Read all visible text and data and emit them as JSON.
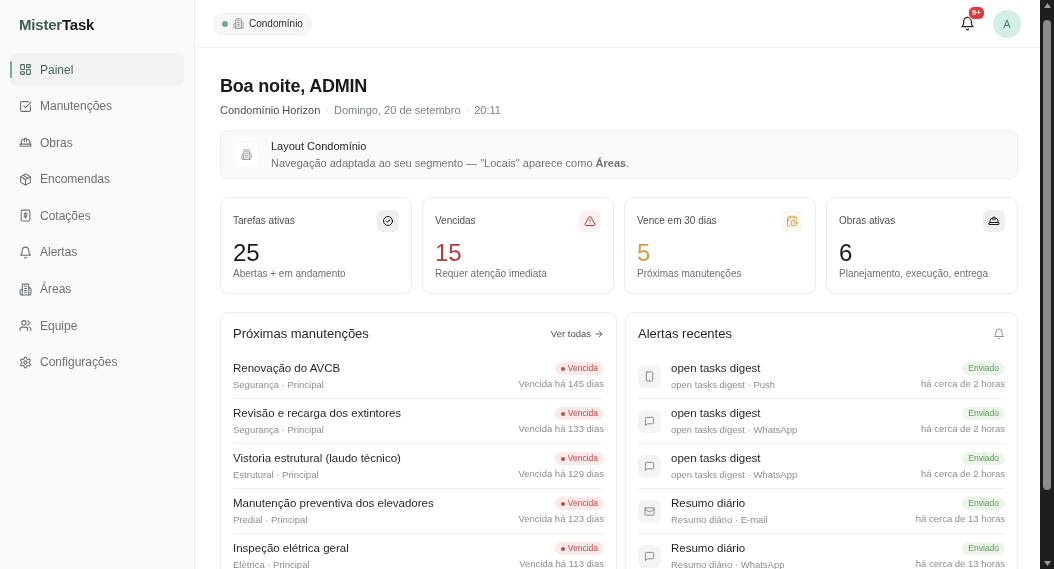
{
  "sidebar": {
    "brand_first": "Mister",
    "brand_second": "Task",
    "items": [
      {
        "label": "Painel",
        "selected": true
      },
      {
        "label": "Manutenções",
        "selected": false
      },
      {
        "label": "Obras",
        "selected": false
      },
      {
        "label": "Encomendas",
        "selected": false
      },
      {
        "label": "Cotações",
        "selected": false
      },
      {
        "label": "Alertas",
        "selected": false
      },
      {
        "label": "Áreas",
        "selected": false
      },
      {
        "label": "Equipe",
        "selected": false
      },
      {
        "label": "Configurações",
        "selected": false
      }
    ]
  },
  "header": {
    "segment": "Condomínio",
    "notification_count": "9+",
    "avatar": "A"
  },
  "greeting": {
    "title": "Boa noite, ADMIN",
    "meta": [
      {
        "kind": "place",
        "text": "Condomínio Horizon"
      },
      {
        "kind": "separator",
        "text": "·"
      },
      {
        "kind": "date",
        "text": "Domingo, 20 de setembro"
      },
      {
        "kind": "separator",
        "text": "·"
      },
      {
        "kind": "time",
        "text": "20:11"
      }
    ]
  },
  "notice": {
    "title": "Layout Condomínio",
    "text": "Navegação adaptada ao seu segmento — \"Locais\" aparece como **Áreas**."
  },
  "stats": [
    {
      "label": "Tarefas ativas",
      "value": "25",
      "caption": "Abertas + em andamento",
      "color": "#1c1c1c"
    },
    {
      "label": "Vencidas",
      "value": "15",
      "caption": "Requer atenção imediata",
      "color": "#b43c3c"
    },
    {
      "label": "Vence em 30 dias",
      "value": "5",
      "caption": "Próximas manutenções",
      "color": "#d39b45"
    },
    {
      "label": "Obras ativas",
      "value": "6",
      "caption": "Planejamento, execução, entrega",
      "color": "#1c1c1c"
    }
  ],
  "maintenance": {
    "title": "Próximas manutenções",
    "link": "Ver todas",
    "rows": [
      {
        "title": "Renovação do AVCB",
        "subtitle": "Segurança · Principal",
        "status": "Vencida",
        "due": "Vencida há 145 dias"
      },
      {
        "title": "Revisão e recarga dos extintores",
        "subtitle": "Segurança · Principal",
        "status": "Vencida",
        "due": "Vencida há 133 dias"
      },
      {
        "title": "Vistoria estrutural (laudo técnico)",
        "subtitle": "Estrutural · Principal",
        "status": "Vencida",
        "due": "Vencida há 129 dias"
      },
      {
        "title": "Manutenção preventiva dos elevadores",
        "subtitle": "Predial · Principal",
        "status": "Vencida",
        "due": "Vencida há 123 dias"
      },
      {
        "title": "Inspeção elétrica geral",
        "subtitle": "Elétrica · Principal",
        "status": "Vencida",
        "due": "Vencida há 113 dias"
      }
    ]
  },
  "alerts": {
    "title": "Alertas recentes",
    "rows": [
      {
        "kind": "push",
        "title": "open tasks digest",
        "subtitle": "open tasks digest · Push",
        "status": "Enviado",
        "time": "há cerca de 2 horas"
      },
      {
        "kind": "chat",
        "title": "open tasks digest",
        "subtitle": "open tasks digest · WhatsApp",
        "status": "Enviado",
        "time": "há cerca de 2 horas"
      },
      {
        "kind": "chat",
        "title": "open tasks digest",
        "subtitle": "open tasks digest · WhatsApp",
        "status": "Enviado",
        "time": "há cerca de 2 horas"
      },
      {
        "kind": "email",
        "title": "Resumo diário",
        "subtitle": "Resumo diário · E-mail",
        "status": "Enviado",
        "time": "há cerca de 13 horas"
      },
      {
        "kind": "chat",
        "title": "Resumo diário",
        "subtitle": "Resumo diário · WhatsApp",
        "status": "Enviado",
        "time": "há cerca de 13 horas"
      }
    ]
  }
}
